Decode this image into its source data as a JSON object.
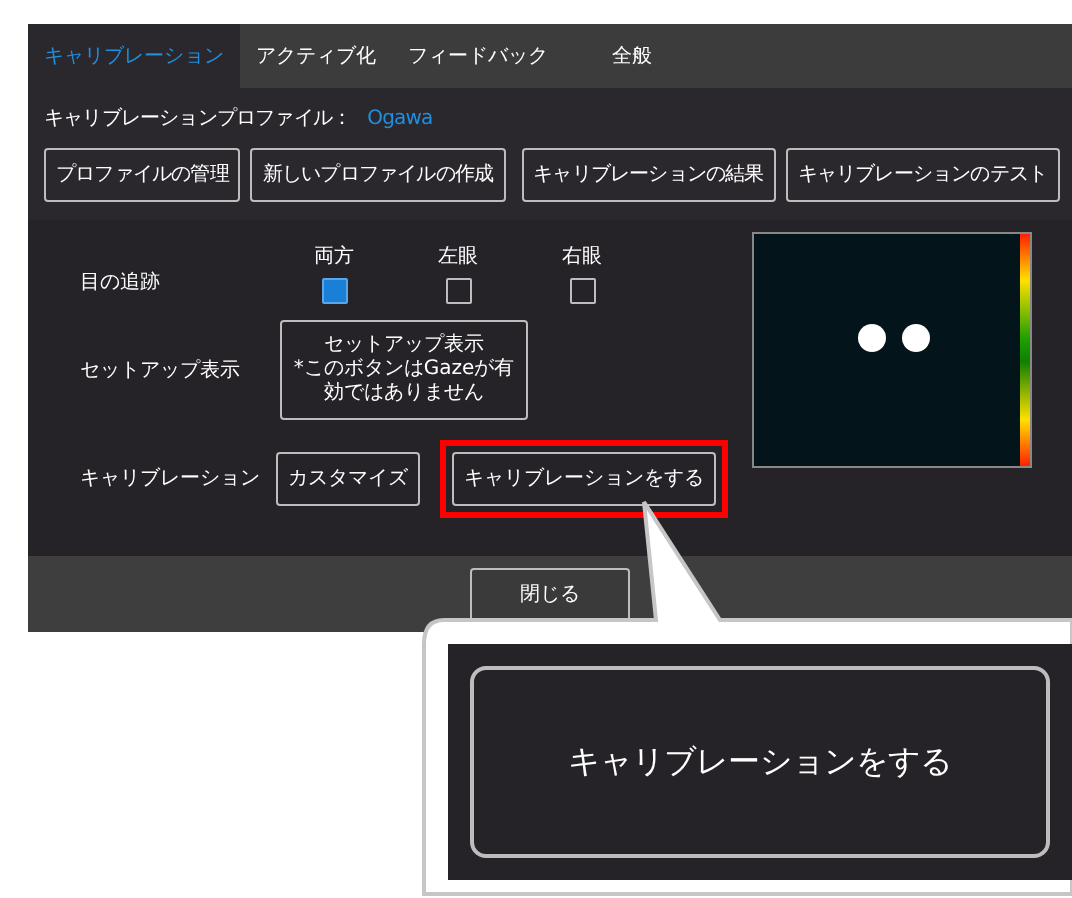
{
  "tabs": [
    {
      "label": "キャリブレーション",
      "selected": true
    },
    {
      "label": "アクティブ化",
      "selected": false
    },
    {
      "label": "フィードバック",
      "selected": false
    },
    {
      "label": "全般",
      "selected": false
    }
  ],
  "profile": {
    "label": "キャリブレーションプロファイル：",
    "value": "Ogawa"
  },
  "profile_buttons": [
    "プロファイルの管理",
    "新しいプロファイルの作成"
  ],
  "calibration_buttons": [
    "キャリブレーションの結果",
    "キャリブレーションのテスト"
  ],
  "eye_tracking": {
    "label": "目の追跡",
    "options": [
      {
        "label": "両方",
        "checked": true
      },
      {
        "label": "左眼",
        "checked": false
      },
      {
        "label": "右眼",
        "checked": false
      }
    ]
  },
  "setup": {
    "label": "セットアップ表示",
    "button": "セットアップ表示",
    "note": "*このボタンはGazeが有効ではありません"
  },
  "calibration": {
    "label": "キャリブレーション",
    "buttons": [
      {
        "label": "カスタマイズ",
        "highlighted": false
      },
      {
        "label": "キャリブレーションをする",
        "highlighted": true
      }
    ]
  },
  "close_button": "閉じる",
  "callout": {
    "button": "キャリブレーションをする"
  }
}
